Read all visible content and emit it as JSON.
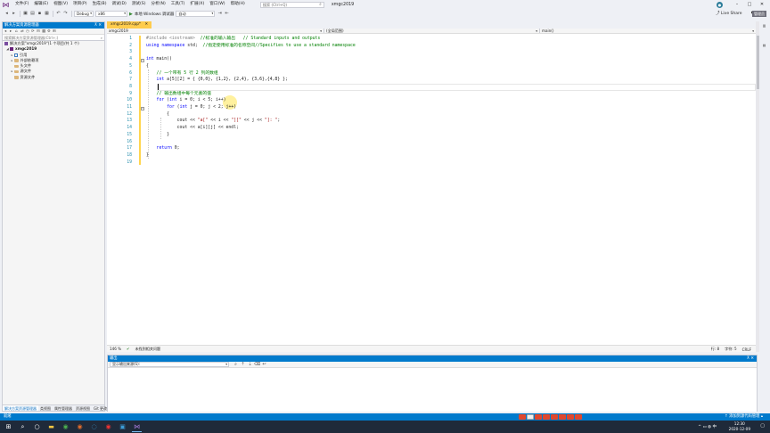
{
  "menubar": {
    "items": [
      "文件(F)",
      "编辑(E)",
      "视图(V)",
      "项目(P)",
      "生成(B)",
      "调试(D)",
      "测试(S)",
      "分析(N)",
      "工具(T)",
      "扩展(X)",
      "窗口(W)",
      "帮助(H)"
    ],
    "search_placeholder": "搜索 (Ctrl+Q)",
    "app_title": "xmgc2019"
  },
  "toolbar": {
    "config": "Debug",
    "platform": "x86",
    "run_label": "本地 Windows 调试器",
    "run_mode": "自动",
    "liveshare": "Live Share",
    "admin_badge": "管理员"
  },
  "solution_explorer": {
    "title": "解决方案资源管理器",
    "search_placeholder": "搜索解决方案资源管理器(Ctrl+;)",
    "tree": [
      {
        "label": "解决方案\"xmgc2019\"(1 个项目/共 1 个)",
        "type": "solution"
      },
      {
        "label": "xmgc2019",
        "type": "project"
      },
      {
        "label": "引用",
        "type": "ref"
      },
      {
        "label": "外部依赖项",
        "type": "folder"
      },
      {
        "label": "头文件",
        "type": "folder"
      },
      {
        "label": "源文件",
        "type": "folder"
      },
      {
        "label": "资源文件",
        "type": "folder"
      }
    ],
    "tabs": [
      "解决方案资源管理器",
      "类视图",
      "属性管理器",
      "资源视图",
      "Git 更改"
    ]
  },
  "editor": {
    "tab_label": "xmgc2019.cpp*",
    "nav": {
      "project": "xmgc2019",
      "scope": "(全局范围)",
      "function": "main()"
    },
    "line_numbers": [
      "1",
      "2",
      "3",
      "4",
      "5",
      "6",
      "7",
      "8",
      "9",
      "10",
      "11",
      "12",
      "13",
      "14",
      "15",
      "16",
      "17",
      "18",
      "19"
    ],
    "lines": {
      "l1a": "#include <iostream>",
      "l1b": "  //标准的输入输出   // Standard inputs and outputs",
      "l2a": "using namespace",
      "l2b": " std;",
      "l2c": "  //指定使用标准的名称空间//Specifies to use a standard namespace",
      "l4a": "int",
      "l4b": " main()",
      "l5": "{",
      "l6": "    // 一个带有 5 行 2 列的数组",
      "l7a": "    int",
      "l7b": " a[5][2] = { {0,0}, {1,2}, {2,4}, {3,6},{4,8} };",
      "l9": "    // 输出数组中每个元素的值",
      "l10a": "    for",
      "l10b": " (",
      "l10c": "int",
      "l10d": " i = 0; i < 5; i++)",
      "l11a": "        for",
      "l11b": " (",
      "l11c": "int",
      "l11d": " j = 0; j < 2; j++)",
      "l12": "        {",
      "l13a": "            cout << ",
      "l13b": "\"a[\"",
      "l13c": " << i << ",
      "l13d": "\"][\"",
      "l13e": " << j << ",
      "l13f": "\"]: \"",
      "l13g": ";",
      "l14": "            cout << a[i][j] << endl;",
      "l15": "        }",
      "l17a": "    return",
      "l17b": " 0;",
      "l18": "}"
    },
    "zoom": "146 %",
    "issues": "未找到相关问题",
    "row": "行: 8",
    "col": "字符: 5",
    "encoding": "CRLF"
  },
  "output": {
    "title": "输出",
    "source_label": "显示输出来源(S):"
  },
  "statusbar": {
    "left": "就绪",
    "right": "↑ 添加到源代码管理 ▴"
  },
  "taskbar": {
    "time": "12:30",
    "date": "2020-12-09"
  }
}
